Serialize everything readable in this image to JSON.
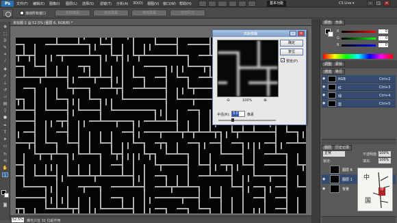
{
  "menubar": {
    "logo": "Ps",
    "items": [
      "文件(F)",
      "编辑(E)",
      "图像(I)",
      "图层(L)",
      "选择(S)",
      "滤镜(T)",
      "分析(A)",
      "3D(D)",
      "视图(V)",
      "窗口(W)",
      "帮助(H)"
    ],
    "workspace": "基本功能",
    "cslive": "CS Live ▾"
  },
  "options": {
    "all_windows_label": "滚动所有窗口",
    "buttons": [
      "实际像素",
      "适合屏幕",
      "填充屏幕",
      "打印尺寸"
    ]
  },
  "document": {
    "title": "未标题-1 @ 52.5% (图层 6, RGB/8) *",
    "zoom": "52.5%",
    "status": "曝光只在 32 位起作用"
  },
  "panels": {
    "color_tabs": [
      "颜色",
      "色板"
    ],
    "sliders": [
      {
        "label": "R",
        "value": "0"
      },
      {
        "label": "G",
        "value": "0"
      },
      {
        "label": "B",
        "value": "0"
      }
    ],
    "adjust_tabs": [
      "调整",
      "蒙版"
    ],
    "channel_tabs": [
      "通道",
      "路径"
    ],
    "channels": [
      {
        "name": "RGB",
        "key": "Ctrl+2"
      },
      {
        "name": "红",
        "key": "Ctrl+3"
      },
      {
        "name": "绿",
        "key": "Ctrl+4"
      },
      {
        "name": "蓝",
        "key": "Ctrl+5"
      }
    ],
    "layer_tabs": [
      "图层",
      "历史记录"
    ],
    "blend_mode": "正常",
    "opacity_label": "不透明度:",
    "opacity": "100%",
    "lock_label": "锁定:",
    "fill_label": "填充:",
    "fill": "100%",
    "layers": [
      {
        "name": "图层 6"
      },
      {
        "name": "图层 1"
      },
      {
        "name": "背景"
      }
    ],
    "stamp_chars": [
      "中",
      "国"
    ],
    "stamp_seal": "印"
  },
  "dialog": {
    "title": "高斯模糊",
    "ok": "确定",
    "reset": "复位",
    "preview_label": "预览(P)",
    "zoom": "100%",
    "zoom_out": "⊖",
    "zoom_in": "⊕",
    "radius_label": "半径(R):",
    "radius_value": "3.0",
    "radius_unit": "像素"
  }
}
